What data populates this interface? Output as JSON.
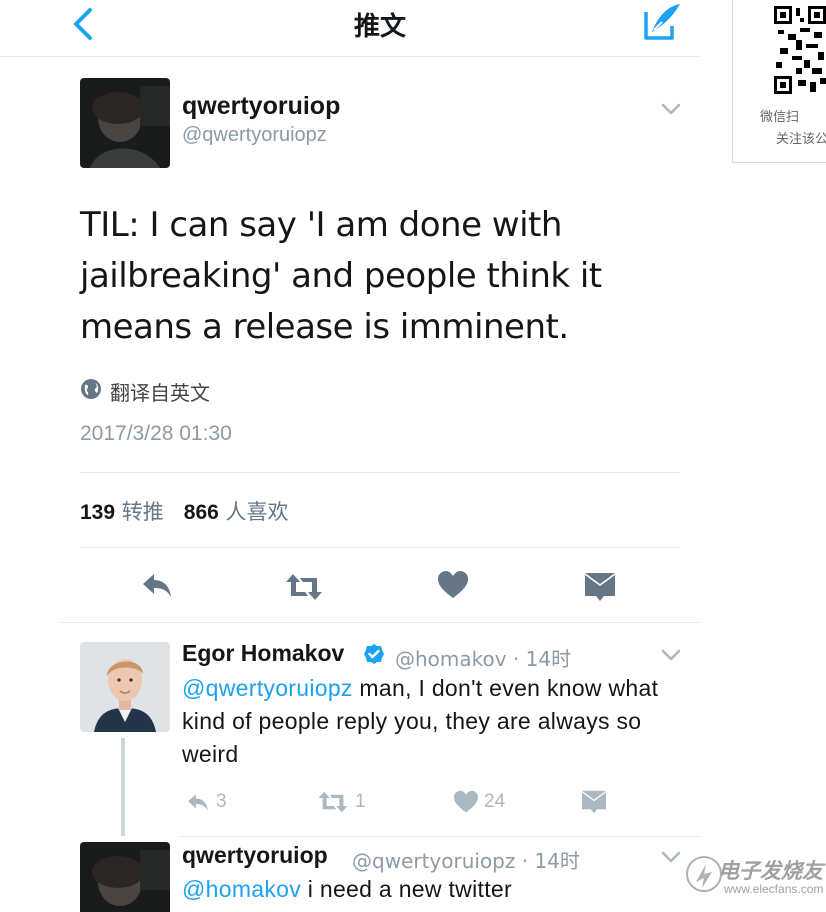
{
  "nav": {
    "title": "推文",
    "back_icon": "chevron-left-icon",
    "compose_icon": "compose-quill-icon"
  },
  "side_panel": {
    "line1": "微信扫",
    "line2": "关注该公"
  },
  "tweet": {
    "author_name": "qwertyoruiop",
    "author_handle": "@qwertyoruiopz",
    "text": "TIL: I can say 'I am done with jailbreaking' and people think it means a release is imminent.",
    "translate_label": "翻译自英文",
    "timestamp": "2017/3/28 01:30",
    "retweets_count": "139",
    "retweets_label": "转推",
    "likes_count": "866",
    "likes_label": "人喜欢"
  },
  "replies": [
    {
      "name": "Egor Homakov",
      "verified": true,
      "handle_time": "@homakov · 14时",
      "mention": "@qwertyoruiopz",
      "text": " man, I don't even know what kind of people reply you, they are always so weird",
      "reply_count": "3",
      "retweet_count": "1",
      "like_count": "24"
    },
    {
      "name": "qwertyoruiop",
      "handle_time": "@qwertyoruiopz · 14时",
      "mention": "@homakov",
      "text": " i need a new twitter"
    }
  ],
  "watermark": {
    "brand": "电子发烧友",
    "url": "www.elecfans.com"
  },
  "colors": {
    "accent": "#1da1f2",
    "text": "#14171a",
    "muted": "#8c9aa6",
    "icon": "#657786",
    "icon_light": "#aab8c2"
  }
}
